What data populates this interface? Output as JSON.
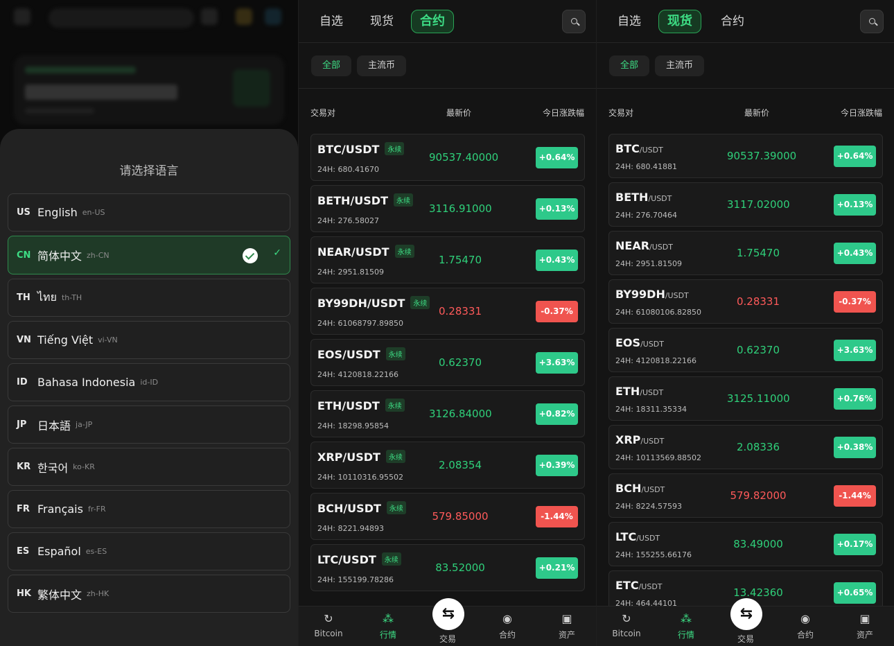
{
  "colors": {
    "accent": "#3ddc84",
    "up": "#2ec98a",
    "down": "#f0544f"
  },
  "language_sheet": {
    "title": "请选择语言",
    "languages": [
      {
        "code": "US",
        "name": "English",
        "locale": "en-US"
      },
      {
        "code": "CN",
        "name": "简体中文",
        "locale": "zh-CN",
        "selected": true
      },
      {
        "code": "TH",
        "name": "ไทย",
        "locale": "th-TH"
      },
      {
        "code": "VN",
        "name": "Tiếng Việt",
        "locale": "vi-VN"
      },
      {
        "code": "ID",
        "name": "Bahasa Indonesia",
        "locale": "id-ID"
      },
      {
        "code": "JP",
        "name": "日本語",
        "locale": "ja-JP"
      },
      {
        "code": "KR",
        "name": "한국어",
        "locale": "ko-KR"
      },
      {
        "code": "FR",
        "name": "Français",
        "locale": "fr-FR"
      },
      {
        "code": "ES",
        "name": "Español",
        "locale": "es-ES"
      },
      {
        "code": "HK",
        "name": "繁体中文",
        "locale": "zh-HK"
      }
    ],
    "check_mark": "✓"
  },
  "market_tabs": {
    "watchlist": "自选",
    "spot": "现货",
    "futures": "合约"
  },
  "sub_tabs": {
    "all": "全部",
    "mainstream": "主流币"
  },
  "columns": {
    "pair": "交易对",
    "price": "最新价",
    "change": "今日涨跌幅"
  },
  "perp_badge": "永续",
  "futures_rows": [
    {
      "pair": "BTC/USDT",
      "vol": "24H: 680.41670",
      "price": "90537.40000",
      "change": "+0.64%",
      "dir": "up"
    },
    {
      "pair": "BETH/USDT",
      "vol": "24H: 276.58027",
      "price": "3116.91000",
      "change": "+0.13%",
      "dir": "up"
    },
    {
      "pair": "NEAR/USDT",
      "vol": "24H: 2951.81509",
      "price": "1.75470",
      "change": "+0.43%",
      "dir": "up"
    },
    {
      "pair": "BY99DH/USDT",
      "vol": "24H: 61068797.89850",
      "price": "0.28331",
      "change": "-0.37%",
      "dir": "down"
    },
    {
      "pair": "EOS/USDT",
      "vol": "24H: 4120818.22166",
      "price": "0.62370",
      "change": "+3.63%",
      "dir": "up"
    },
    {
      "pair": "ETH/USDT",
      "vol": "24H: 18298.95854",
      "price": "3126.84000",
      "change": "+0.82%",
      "dir": "up"
    },
    {
      "pair": "XRP/USDT",
      "vol": "24H: 10110316.95502",
      "price": "2.08354",
      "change": "+0.39%",
      "dir": "up"
    },
    {
      "pair": "BCH/USDT",
      "vol": "24H: 8221.94893",
      "price": "579.85000",
      "change": "-1.44%",
      "dir": "down"
    },
    {
      "pair": "LTC/USDT",
      "vol": "24H: 155199.78286",
      "price": "83.52000",
      "change": "+0.21%",
      "dir": "up"
    }
  ],
  "spot_rows": [
    {
      "base": "BTC",
      "quote": "/USDT",
      "vol": "24H: 680.41881",
      "price": "90537.39000",
      "change": "+0.64%",
      "dir": "up"
    },
    {
      "base": "BETH",
      "quote": "/USDT",
      "vol": "24H: 276.70464",
      "price": "3117.02000",
      "change": "+0.13%",
      "dir": "up"
    },
    {
      "base": "NEAR",
      "quote": "/USDT",
      "vol": "24H: 2951.81509",
      "price": "1.75470",
      "change": "+0.43%",
      "dir": "up"
    },
    {
      "base": "BY99DH",
      "quote": "/USDT",
      "vol": "24H: 61080106.82850",
      "price": "0.28331",
      "change": "-0.37%",
      "dir": "down"
    },
    {
      "base": "EOS",
      "quote": "/USDT",
      "vol": "24H: 4120818.22166",
      "price": "0.62370",
      "change": "+3.63%",
      "dir": "up"
    },
    {
      "base": "ETH",
      "quote": "/USDT",
      "vol": "24H: 18311.35334",
      "price": "3125.11000",
      "change": "+0.76%",
      "dir": "up"
    },
    {
      "base": "XRP",
      "quote": "/USDT",
      "vol": "24H: 10113569.88502",
      "price": "2.08336",
      "change": "+0.38%",
      "dir": "up"
    },
    {
      "base": "BCH",
      "quote": "/USDT",
      "vol": "24H: 8224.57593",
      "price": "579.82000",
      "change": "-1.44%",
      "dir": "down"
    },
    {
      "base": "LTC",
      "quote": "/USDT",
      "vol": "24H: 155255.66176",
      "price": "83.49000",
      "change": "+0.17%",
      "dir": "up"
    },
    {
      "base": "ETC",
      "quote": "/USDT",
      "vol": "24H: 464.44101",
      "price": "13.42360",
      "change": "+0.65%",
      "dir": "up"
    }
  ],
  "nav": {
    "home": "Bitcoin",
    "market": "行情",
    "trade": "交易",
    "futures": "合约",
    "assets": "资产",
    "icons": {
      "home": "swap-logo-icon",
      "market": "market-dots-icon",
      "trade": "exchange-arrows-icon",
      "futures": "money-bag-icon",
      "assets": "wallet-bag-icon"
    }
  }
}
